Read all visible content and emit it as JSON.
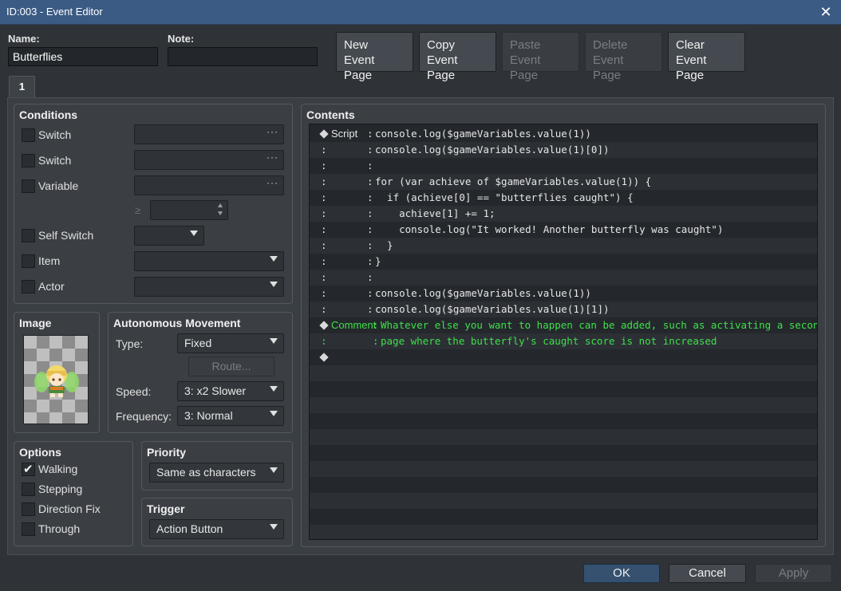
{
  "window": {
    "title": "ID:003 - Event Editor",
    "close_glyph": "✕"
  },
  "name": {
    "label": "Name:",
    "value": "Butterflies"
  },
  "note": {
    "label": "Note:",
    "value": ""
  },
  "page_buttons": [
    {
      "line1": "New",
      "line2": "Event Page",
      "enabled": true
    },
    {
      "line1": "Copy",
      "line2": "Event Page",
      "enabled": true
    },
    {
      "line1": "Paste",
      "line2": "Event Page",
      "enabled": false
    },
    {
      "line1": "Delete",
      "line2": "Event Page",
      "enabled": false
    },
    {
      "line1": "Clear",
      "line2": "Event Page",
      "enabled": true
    }
  ],
  "tabs": [
    {
      "label": "1"
    }
  ],
  "conditions": {
    "title": "Conditions",
    "rows": [
      {
        "label": "Switch",
        "checked": false,
        "value": "",
        "control": "dots"
      },
      {
        "label": "Switch",
        "checked": false,
        "value": "",
        "control": "dots"
      },
      {
        "label": "Variable",
        "checked": false,
        "value": "",
        "control": "dots"
      },
      {
        "label": "Self Switch",
        "checked": false,
        "value": "",
        "control": "dropdown"
      },
      {
        "label": "Item",
        "checked": false,
        "value": "",
        "control": "dropdown"
      },
      {
        "label": "Actor",
        "checked": false,
        "value": "",
        "control": "dropdown"
      }
    ],
    "comparator": "≥",
    "variable_value": ""
  },
  "image": {
    "title": "Image",
    "sprite": "butterfly-character"
  },
  "autonomous_movement": {
    "title": "Autonomous Movement",
    "type_label": "Type:",
    "type_value": "Fixed",
    "route_label": "Route...",
    "speed_label": "Speed:",
    "speed_value": "3: x2 Slower",
    "frequency_label": "Frequency:",
    "frequency_value": "3: Normal"
  },
  "options": {
    "title": "Options",
    "items": [
      {
        "label": "Walking",
        "checked": true
      },
      {
        "label": "Stepping",
        "checked": false
      },
      {
        "label": "Direction Fix",
        "checked": false
      },
      {
        "label": "Through",
        "checked": false
      }
    ]
  },
  "priority": {
    "title": "Priority",
    "value": "Same as characters"
  },
  "trigger": {
    "title": "Trigger",
    "value": "Action Button"
  },
  "contents": {
    "title": "Contents",
    "lines": [
      {
        "marker": "diamond",
        "label": "Script",
        "sep": ":",
        "code": "console.log($gameVariables.value(1))",
        "green": false
      },
      {
        "marker": ":",
        "label": "",
        "sep": ":",
        "code": "console.log($gameVariables.value(1)[0])",
        "green": false
      },
      {
        "marker": ":",
        "label": "",
        "sep": ":",
        "code": "",
        "green": false
      },
      {
        "marker": ":",
        "label": "",
        "sep": ":",
        "code": "for (var achieve of $gameVariables.value(1)) {",
        "green": false
      },
      {
        "marker": ":",
        "label": "",
        "sep": ":",
        "code": "  if (achieve[0] == \"butterflies caught\") {",
        "green": false
      },
      {
        "marker": ":",
        "label": "",
        "sep": ":",
        "code": "    achieve[1] += 1;",
        "green": false
      },
      {
        "marker": ":",
        "label": "",
        "sep": ":",
        "code": "    console.log(\"It worked! Another butterfly was caught\")",
        "green": false
      },
      {
        "marker": ":",
        "label": "",
        "sep": ":",
        "code": "  }",
        "green": false
      },
      {
        "marker": ":",
        "label": "",
        "sep": ":",
        "code": "}",
        "green": false
      },
      {
        "marker": ":",
        "label": "",
        "sep": ":",
        "code": "",
        "green": false
      },
      {
        "marker": ":",
        "label": "",
        "sep": ":",
        "code": "console.log($gameVariables.value(1))",
        "green": false
      },
      {
        "marker": ":",
        "label": "",
        "sep": ":",
        "code": "console.log($gameVariables.value(1)[1])",
        "green": false
      },
      {
        "marker": "diamond",
        "label": "Comment",
        "sep": ":",
        "code": "Whatever else you want to happen can be added, such as activating a second",
        "green": true
      },
      {
        "marker": ":",
        "label": "",
        "sep": ":",
        "code": "page where the butterfly's caught score is not increased",
        "green": true
      },
      {
        "marker": "diamond",
        "label": "",
        "sep": "",
        "code": "",
        "green": false
      }
    ]
  },
  "footer": {
    "ok": "OK",
    "cancel": "Cancel",
    "apply": "Apply"
  },
  "colors": {
    "titlebar": "#3b5b84",
    "background": "#2f3338",
    "comment_green": "#3ee04a"
  }
}
